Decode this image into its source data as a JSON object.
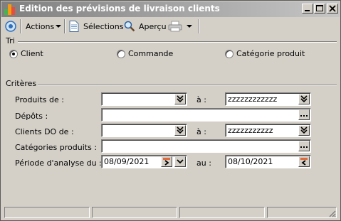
{
  "window": {
    "title": "Edition des prévisions de livraison clients"
  },
  "toolbar": {
    "actions_label": "Actions",
    "selections_label": "Sélections",
    "apercu_label": "Aperçu"
  },
  "sort": {
    "title": "Tri",
    "options": [
      {
        "label": "Client",
        "checked": true
      },
      {
        "label": "Commande",
        "checked": false
      },
      {
        "label": "Catégorie produit",
        "checked": false
      }
    ]
  },
  "criteria": {
    "title": "Critères",
    "produits_label": "Produits de  :",
    "produits_from": "",
    "produits_a_label": "à :",
    "produits_to": "zzzzzzzzzzzz",
    "depots_label": "Dépôts :",
    "depots_value": "",
    "clients_label": "Clients DO de :",
    "clients_from": "",
    "clients_a_label": "à :",
    "clients_to": "zzzzzzzzzzz",
    "categories_label": "Catégories produits :",
    "categories_value": "",
    "periode_label": "Période d'analyse du :",
    "periode_from": "08/09/2021",
    "periode_au_label": "au :",
    "periode_to": "08/10/2021"
  },
  "icons": {
    "app": "app-logo-icon",
    "toolbar_left": "circle-target-icon",
    "selections": "document-icon",
    "apercu": "magnifier-icon",
    "print": "printer-icon",
    "dropdown": "double-chevron-down-icon",
    "ellipsis": "ellipsis-icon",
    "calendar": "calendar-icon"
  }
}
